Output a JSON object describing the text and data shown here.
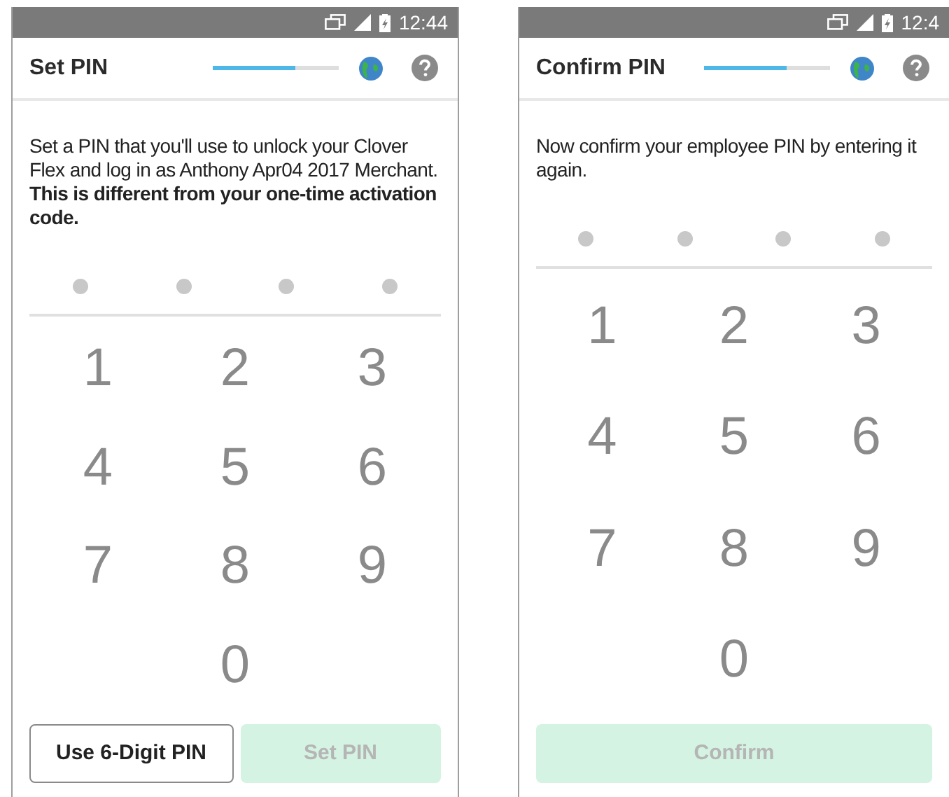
{
  "screens": [
    {
      "status_bar": {
        "time": "12:44"
      },
      "header": {
        "title": "Set PIN",
        "progress": {
          "level": 0.66
        }
      },
      "message": "Set a PIN that you'll use to unlock your Clover Flex and log in as Anthony Apr04 2017 Merchant. **This is different from your one-time activation code.**",
      "dots": [
        {
          "filled": false
        },
        {
          "filled": false
        },
        {
          "filled": false
        },
        {
          "filled": false
        }
      ],
      "keys": [
        "1",
        "2",
        "3",
        "4",
        "5",
        "6",
        "7",
        "8",
        "9",
        "0"
      ],
      "buttons": [
        {
          "label": "Use 6-Digit PIN",
          "kind": "outline",
          "disabled": false
        },
        {
          "label": "Set PIN",
          "kind": "primary",
          "disabled": true
        }
      ]
    },
    {
      "status_bar": {
        "time": "12:4"
      },
      "header": {
        "title": "Confirm PIN",
        "progress": {
          "level": 0.66
        }
      },
      "message": "Now confirm your employee PIN by entering it again.",
      "dots": [
        {
          "filled": false
        },
        {
          "filled": false
        },
        {
          "filled": false
        },
        {
          "filled": false
        }
      ],
      "keys": [
        "1",
        "2",
        "3",
        "4",
        "5",
        "6",
        "7",
        "8",
        "9",
        "0"
      ],
      "buttons": [
        {
          "label": "Confirm",
          "kind": "primary",
          "disabled": true
        }
      ]
    }
  ]
}
